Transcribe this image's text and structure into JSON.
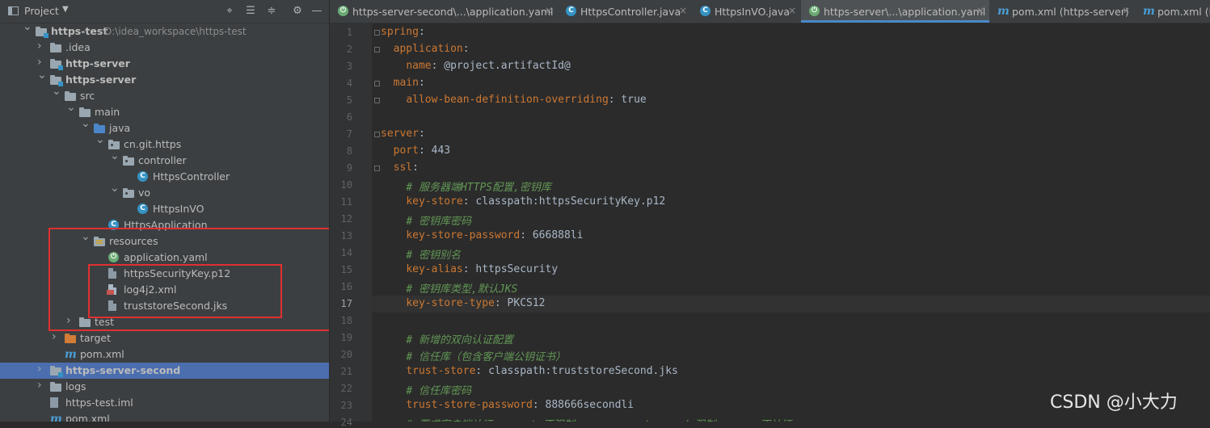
{
  "panel": {
    "title": "Project",
    "toolbar": [
      "crosshair-icon",
      "expand-all-icon",
      "collapse-all-icon",
      "gear-icon",
      "hide-icon"
    ]
  },
  "tree": [
    {
      "label": "https-test",
      "path": "D:\\idea_workspace\\https-test",
      "icon": "module-folder",
      "expanded": true,
      "bold": true
    },
    {
      "label": ".idea",
      "icon": "folder",
      "expanded": false
    },
    {
      "label": "http-server",
      "icon": "module-folder",
      "expanded": false,
      "bold": true
    },
    {
      "label": "https-server",
      "icon": "module-folder",
      "expanded": true,
      "bold": true
    },
    {
      "label": "src",
      "icon": "folder",
      "expanded": true
    },
    {
      "label": "main",
      "icon": "folder",
      "expanded": true
    },
    {
      "label": "java",
      "icon": "source-folder",
      "expanded": true
    },
    {
      "label": "cn.git.https",
      "icon": "package",
      "expanded": true
    },
    {
      "label": "controller",
      "icon": "package",
      "expanded": true
    },
    {
      "label": "HttpsController",
      "icon": "class"
    },
    {
      "label": "vo",
      "icon": "package",
      "expanded": true
    },
    {
      "label": "HttpsInVO",
      "icon": "class"
    },
    {
      "label": "HttpsApplication",
      "icon": "spring-class"
    },
    {
      "label": "resources",
      "icon": "resources-folder",
      "expanded": true
    },
    {
      "label": "application.yaml",
      "icon": "spring-config"
    },
    {
      "label": "httpsSecurityKey.p12",
      "icon": "key-file"
    },
    {
      "label": "log4j2.xml",
      "icon": "xml-file"
    },
    {
      "label": "truststoreSecond.jks",
      "icon": "key-file"
    },
    {
      "label": "test",
      "icon": "folder",
      "expanded": false
    },
    {
      "label": "target",
      "icon": "excluded-folder",
      "expanded": false
    },
    {
      "label": "pom.xml",
      "icon": "maven"
    },
    {
      "label": "https-server-second",
      "icon": "module-folder",
      "expanded": false,
      "bold": true,
      "selected": true
    },
    {
      "label": "logs",
      "icon": "folder",
      "expanded": false
    },
    {
      "label": "https-test.iml",
      "icon": "iml-file"
    },
    {
      "label": "pom.xml",
      "icon": "maven"
    }
  ],
  "tabs": [
    {
      "label": "https-server-second\\...\\application.yaml",
      "icon": "spring-config",
      "active": false
    },
    {
      "label": "HttpsController.java",
      "icon": "class",
      "active": false
    },
    {
      "label": "HttpsInVO.java",
      "icon": "class",
      "active": false
    },
    {
      "label": "https-server\\...\\application.yaml",
      "icon": "spring-config",
      "active": true
    },
    {
      "label": "pom.xml (https-server)",
      "icon": "maven",
      "active": false
    },
    {
      "label": "pom.xml (h",
      "icon": "maven",
      "active": false
    }
  ],
  "editor": {
    "current_line": 17,
    "lines": [
      {
        "n": 1,
        "indent": "",
        "key": "spring",
        "sep": ":",
        "val": "",
        "comment": ""
      },
      {
        "n": 2,
        "indent": "  ",
        "key": "application",
        "sep": ":",
        "val": "",
        "comment": ""
      },
      {
        "n": 3,
        "indent": "    ",
        "key": "name",
        "sep": ": ",
        "val": "@project.artifactId@",
        "comment": ""
      },
      {
        "n": 4,
        "indent": "  ",
        "key": "main",
        "sep": ":",
        "val": "",
        "comment": ""
      },
      {
        "n": 5,
        "indent": "    ",
        "key": "allow-bean-definition-overriding",
        "sep": ": ",
        "val": "true",
        "comment": ""
      },
      {
        "n": 6,
        "indent": "",
        "key": "",
        "sep": "",
        "val": "",
        "comment": ""
      },
      {
        "n": 7,
        "indent": "",
        "key": "server",
        "sep": ":",
        "val": "",
        "comment": ""
      },
      {
        "n": 8,
        "indent": "  ",
        "key": "port",
        "sep": ": ",
        "val": "443",
        "comment": ""
      },
      {
        "n": 9,
        "indent": "  ",
        "key": "ssl",
        "sep": ":",
        "val": "",
        "comment": ""
      },
      {
        "n": 10,
        "indent": "    ",
        "key": "",
        "sep": "",
        "val": "",
        "comment": "# 服务器端HTTPS配置,密钥库"
      },
      {
        "n": 11,
        "indent": "    ",
        "key": "key-store",
        "sep": ": ",
        "val": "classpath:httpsSecurityKey.p12",
        "comment": ""
      },
      {
        "n": 12,
        "indent": "    ",
        "key": "",
        "sep": "",
        "val": "",
        "comment": "# 密钥库密码"
      },
      {
        "n": 13,
        "indent": "    ",
        "key": "key-store-password",
        "sep": ": ",
        "val": "666888li",
        "comment": ""
      },
      {
        "n": 14,
        "indent": "    ",
        "key": "",
        "sep": "",
        "val": "",
        "comment": "# 密钥别名"
      },
      {
        "n": 15,
        "indent": "    ",
        "key": "key-alias",
        "sep": ": ",
        "val": "httpsSecurity",
        "comment": ""
      },
      {
        "n": 16,
        "indent": "    ",
        "key": "",
        "sep": "",
        "val": "",
        "comment": "# 密钥库类型,默认JKS"
      },
      {
        "n": 17,
        "indent": "    ",
        "key": "key-store-type",
        "sep": ": ",
        "val": "PKCS12",
        "comment": ""
      },
      {
        "n": 18,
        "indent": "",
        "key": "",
        "sep": "",
        "val": "",
        "comment": ""
      },
      {
        "n": 19,
        "indent": "    ",
        "key": "",
        "sep": "",
        "val": "",
        "comment": "# 新增的双向认证配置"
      },
      {
        "n": 20,
        "indent": "    ",
        "key": "",
        "sep": "",
        "val": "",
        "comment": "# 信任库（包含客户端公钥证书）"
      },
      {
        "n": 21,
        "indent": "    ",
        "key": "trust-store",
        "sep": ": ",
        "val": "classpath:truststoreSecond.jks",
        "comment": ""
      },
      {
        "n": 22,
        "indent": "    ",
        "key": "",
        "sep": "",
        "val": "",
        "comment": "# 信任库密码"
      },
      {
        "n": 23,
        "indent": "    ",
        "key": "trust-store-password",
        "sep": ": ",
        "val": "888666secondli",
        "comment": ""
      },
      {
        "n": 24,
        "indent": "    ",
        "key": "",
        "sep": "",
        "val": "",
        "comment": "# 要求客户端认证 : want-不强制announcement, need-强制, none-不认证"
      }
    ]
  },
  "watermark": "CSDN @小大力",
  "colors": {
    "annotation": "#e03030",
    "selection": "#4b6eaf",
    "tab_underline": "#4a88c7",
    "keyword": "#cc7832",
    "comment": "#629755"
  }
}
